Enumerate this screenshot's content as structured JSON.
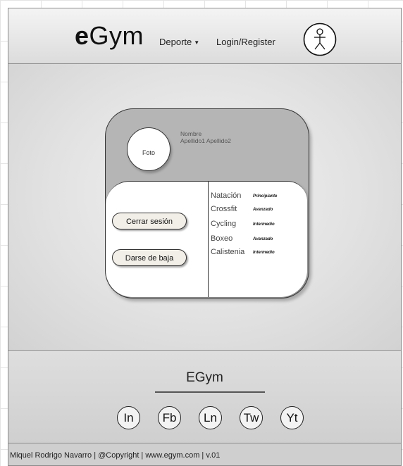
{
  "header": {
    "logo_bold": "e",
    "logo_rest": "Gym",
    "nav_deporte": "Deporte",
    "nav_login": "Login/Register",
    "user_icon": "user-icon"
  },
  "profile": {
    "photo_label": "Foto",
    "name": "Nombre",
    "surnames": "Apellido1  Apellido2",
    "buttons": {
      "logout": "Cerrar sesión",
      "unsubscribe": "Darse de baja"
    },
    "sports": [
      {
        "name": "Natación",
        "level": "Principiante"
      },
      {
        "name": "Crossfit",
        "level": "Avanzado"
      },
      {
        "name": "Cycling",
        "level": "Intermedio"
      },
      {
        "name": "Boxeo",
        "level": "Avanzado"
      },
      {
        "name": "Calistenia",
        "level": "Intermedio"
      }
    ]
  },
  "footer": {
    "title": "EGym",
    "social": [
      {
        "label": "In",
        "icon": "instagram-icon"
      },
      {
        "label": "Fb",
        "icon": "facebook-icon"
      },
      {
        "label": "Ln",
        "icon": "linkedin-icon"
      },
      {
        "label": "Tw",
        "icon": "twitter-icon"
      },
      {
        "label": "Yt",
        "icon": "youtube-icon"
      }
    ],
    "copyright": "Miquel Rodrigo Navarro | @Copyright | www.egym.com | v.01"
  }
}
